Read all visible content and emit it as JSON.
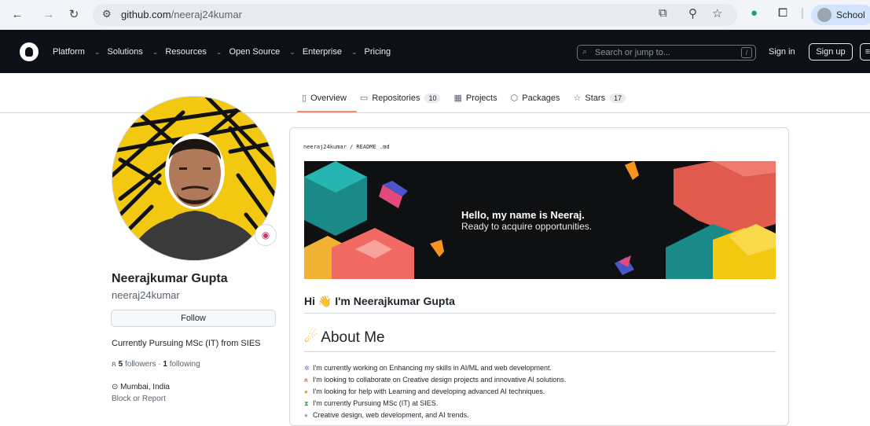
{
  "browser": {
    "back_icon": "arrow-left-icon",
    "forward_icon": "arrow-right-icon",
    "reload_icon": "reload-icon",
    "url_domain": "github.com",
    "url_path": "/neeraj24kumar",
    "profile_label": "School"
  },
  "header": {
    "nav": [
      "Platform",
      "Solutions",
      "Resources",
      "Open Source",
      "Enterprise",
      "Pricing"
    ],
    "search_placeholder": "Search or jump to...",
    "search_shortcut": "/",
    "signin": "Sign in",
    "signup": "Sign up"
  },
  "tabs": [
    {
      "label": "Overview",
      "count": null
    },
    {
      "label": "Repositories",
      "count": "10"
    },
    {
      "label": "Projects",
      "count": null
    },
    {
      "label": "Packages",
      "count": null
    },
    {
      "label": "Stars",
      "count": "17"
    }
  ],
  "profile": {
    "name": "Neerajkumar Gupta",
    "login": "neeraj24kumar",
    "follow_label": "Follow",
    "bio": "Currently Pursuing MSc (IT) from SIES",
    "followers_count": "5",
    "followers_label": "followers",
    "separator": "·",
    "following_count": "1",
    "following_label": "following",
    "location": "Mumbai, India",
    "block_report": "Block or Report"
  },
  "readme": {
    "path": "neeraj24kumar / README .md",
    "banner_line1": "Hello, my name is Neeraj.",
    "banner_line2": "Ready to acquire opportunities.",
    "hi_text": "Hi 👋 I'm Neerajkumar Gupta",
    "about_title": "About Me",
    "items": [
      "I'm currently working on Enhancing my skills in AI/ML and web development.",
      "I'm looking to collaborate on Creative design projects and innovative AI solutions.",
      "I'm looking for help with Learning and developing advanced AI techniques.",
      "I'm currently Pursuing MSc (IT) at SIES.",
      "Creative design, web development, and AI trends."
    ]
  },
  "colors": {
    "header_bg": "#0d1117",
    "tab_underline": "#fd8c73",
    "avatar_yellow": "#f2c811"
  }
}
